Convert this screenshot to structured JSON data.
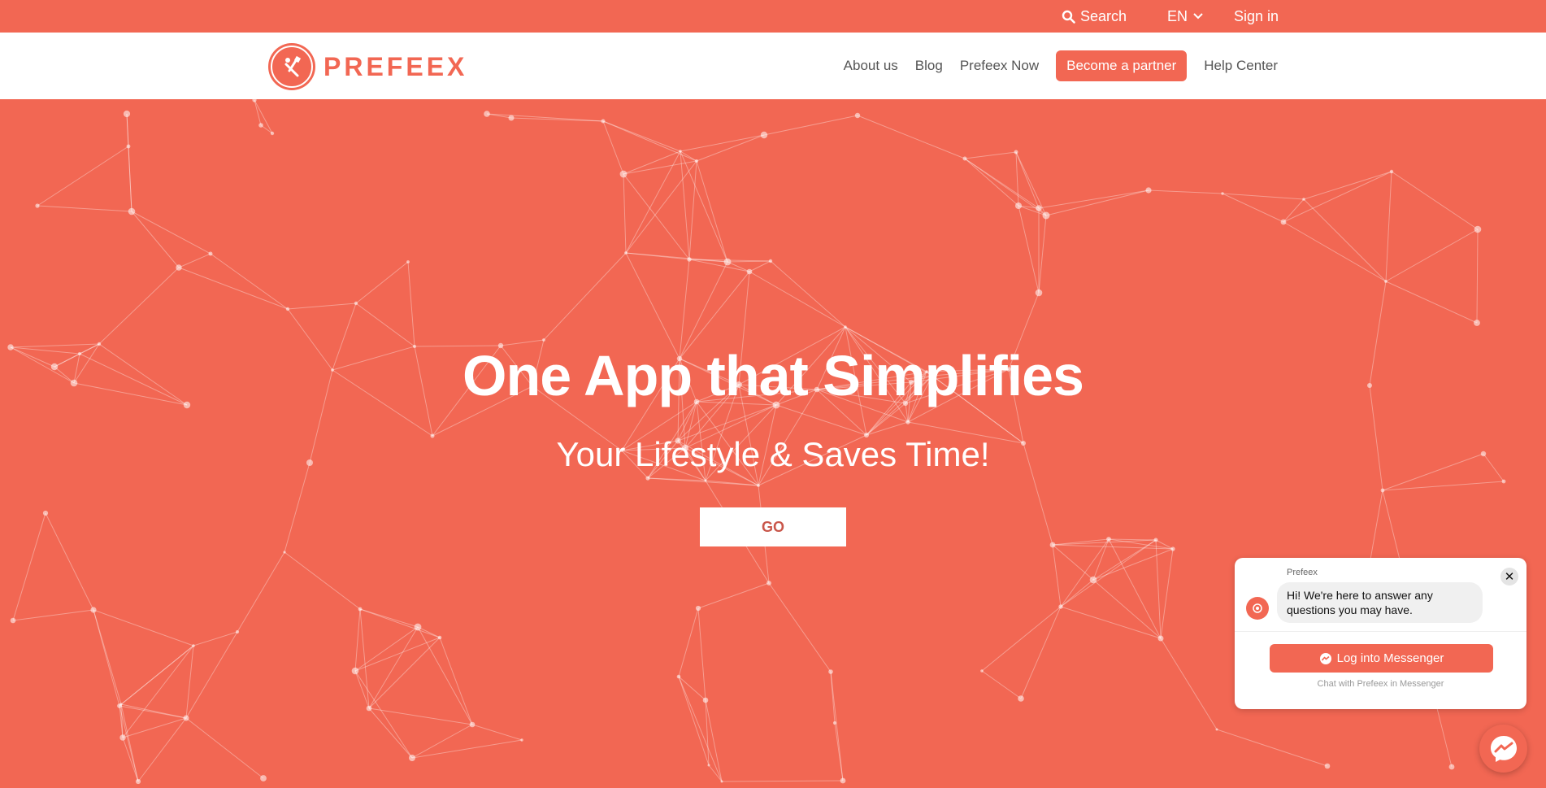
{
  "colors": {
    "brand": "#f26753",
    "navbar_bg": "#ffffff",
    "go_text": "#c9564a"
  },
  "topbar": {
    "search_label": "Search",
    "language": "EN",
    "signin_label": "Sign in",
    "icons": {
      "search": "search-icon",
      "language_toggle": "chevron-down-icon"
    }
  },
  "navbar": {
    "logo_text": "PREFEEX",
    "links": {
      "about": "About us",
      "blog": "Blog",
      "prefeex_now": "Prefeex Now",
      "partner": "Become a partner",
      "help": "Help Center"
    }
  },
  "hero": {
    "headline": "One App that Simplifies",
    "subline": "Your Lifestyle & Saves Time!",
    "cta_label": "GO"
  },
  "chat": {
    "sender": "Prefeex",
    "message": "Hi! We're here to answer any questions you may have.",
    "close_label": "✕",
    "login_label": "Log into Messenger",
    "footer": "Chat with Prefeex in Messenger",
    "icons": {
      "close": "close-icon",
      "messenger": "messenger-icon"
    }
  }
}
